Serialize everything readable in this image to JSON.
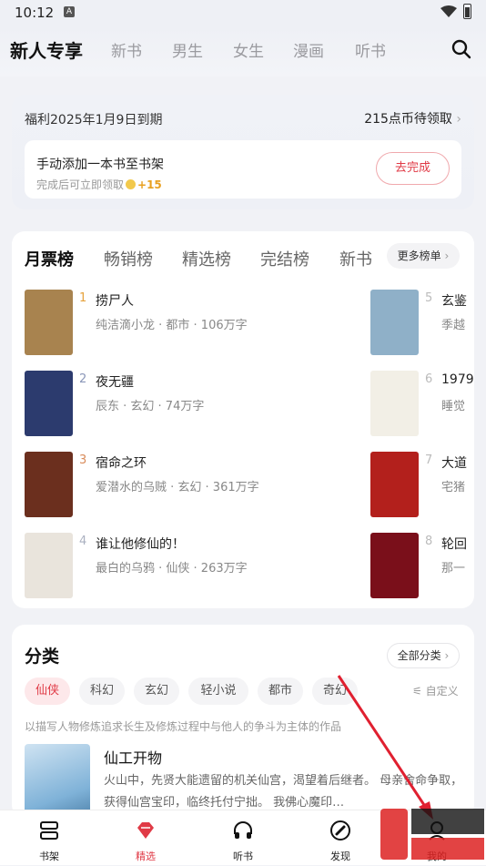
{
  "status": {
    "time": "10:12",
    "a": "A"
  },
  "topnav": {
    "tabs": [
      "新人专享",
      "新书",
      "男生",
      "女生",
      "漫画",
      "听书"
    ]
  },
  "welfare": {
    "deadline": "福利2025年1月9日到期",
    "coins": "215点币待领取",
    "task_title": "手动添加一本书至书架",
    "task_sub": "完成后可立即领取",
    "task_reward": "+15",
    "task_button": "去完成"
  },
  "ranking": {
    "tabs": [
      "月票榜",
      "畅销榜",
      "精选榜",
      "完结榜",
      "新书"
    ],
    "more": "更多榜单",
    "books": [
      {
        "rank": "1",
        "title": "捞尸人",
        "meta": "纯洁滴小龙 · 都市 · 106万字",
        "cover": "#a8834f"
      },
      {
        "rank": "2",
        "title": "夜无疆",
        "meta": "辰东 · 玄幻 · 74万字",
        "cover": "#2c3b6e"
      },
      {
        "rank": "3",
        "title": "宿命之环",
        "meta": "爱潜水的乌贼 · 玄幻 · 361万字",
        "cover": "#6b2f1e"
      },
      {
        "rank": "4",
        "title": "谁让他修仙的！",
        "meta": "最白的乌鸦 · 仙侠 · 263万字",
        "cover": "#e9e4dc"
      },
      {
        "rank": "5",
        "title": "玄鉴",
        "meta": "季越",
        "cover": "#8fb0c8"
      },
      {
        "rank": "6",
        "title": "1979",
        "meta": "睡觉",
        "cover": "#f2efe6"
      },
      {
        "rank": "7",
        "title": "大道",
        "meta": "宅猪",
        "cover": "#b3201c"
      },
      {
        "rank": "8",
        "title": "轮回",
        "meta": "那一",
        "cover": "#7a0f1a"
      }
    ],
    "rank_colors": [
      "#e6a23c",
      "#8a96b8",
      "#d98b5a",
      "#aab0c0",
      "#bbbbbb",
      "#bbbbbb",
      "#bbbbbb",
      "#bbbbbb"
    ]
  },
  "category": {
    "title": "分类",
    "all": "全部分类",
    "chips": [
      "仙侠",
      "科幻",
      "玄幻",
      "轻小说",
      "都市",
      "奇幻"
    ],
    "custom": "自定义",
    "desc": "以描写人物修炼追求长生及修炼过程中与他人的争斗为主体的作品",
    "book_title": "仙工开物",
    "book_desc": "火山中，先贤大能遗留的机关仙宫，渴望着后继者。 母亲舍命争取，获得仙宫宝印，临终托付宁拙。 我佛心魔印…"
  },
  "bottom_nav": [
    "书架",
    "精选",
    "听书",
    "发现",
    "我的"
  ],
  "accent": "#e03a46"
}
